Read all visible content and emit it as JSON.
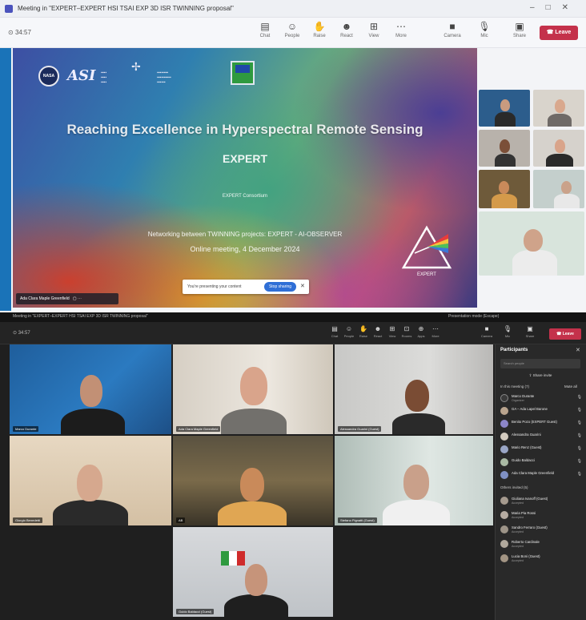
{
  "top_window": {
    "title": "Meeting in \"EXPERT–EXPERT HSI TSAI EXP 3D ISR TWINNING proposal\"",
    "timer": "34:57",
    "toolbar": [
      {
        "icon": "chat-icon",
        "label": "Chat"
      },
      {
        "icon": "people-icon",
        "label": "People"
      },
      {
        "icon": "raise-hand-icon",
        "label": "Raise"
      },
      {
        "icon": "react-icon",
        "label": "React"
      },
      {
        "icon": "view-icon",
        "label": "View"
      },
      {
        "icon": "more-icon",
        "label": "More"
      },
      {
        "icon": "camera-icon",
        "label": "Camera"
      },
      {
        "icon": "mic-icon",
        "label": "Mic"
      },
      {
        "icon": "share-icon",
        "label": "Share"
      }
    ],
    "leave_label": "Leave",
    "slide": {
      "logo_nasa": "NASA",
      "logo_asi": "ASI",
      "title": "Reaching Excellence in Hyperspectral Remote Sensing",
      "subtitle": "EXPERT",
      "consortium": "EXPERT Consortium",
      "networking": "Networking between TWINNING projects: EXPERT - AI-OBSERVER",
      "online": "Online meeting, 4 December 2024",
      "prism_label": "EXPERT"
    },
    "share_bar": {
      "text": "You're presenting your content",
      "stop_label": "Stop sharing"
    },
    "presenter_name": "Ada Clara Maple Greenfield"
  },
  "bottom_window": {
    "title": "Meeting in \"EXPERT–EXPERT HSI TSAI EXP 3D ISR TWINNING proposal\"",
    "title_right": "Presentation mode (Escape)",
    "timer": "34:57",
    "toolbar": [
      {
        "icon": "chat-icon",
        "label": "Chat"
      },
      {
        "icon": "people-icon",
        "label": "People"
      },
      {
        "icon": "raise-hand-icon",
        "label": "Raise"
      },
      {
        "icon": "react-icon",
        "label": "React"
      },
      {
        "icon": "view-icon",
        "label": "View"
      },
      {
        "icon": "rooms-icon",
        "label": "Rooms"
      },
      {
        "icon": "apps-icon",
        "label": "Apps"
      },
      {
        "icon": "more-icon",
        "label": "More"
      },
      {
        "icon": "camera-icon",
        "label": "Camera"
      },
      {
        "icon": "mic-icon",
        "label": "Mic"
      },
      {
        "icon": "share-icon",
        "label": "Share"
      }
    ],
    "leave_label": "Leave",
    "tiles": [
      {
        "name": "Marco Durante"
      },
      {
        "name": "Ada Clara Maple Greenfield"
      },
      {
        "name": "Alessandra Guarini (Guest)"
      },
      {
        "name": "Giorgio Benedetti"
      },
      {
        "name": "AB"
      },
      {
        "name": "Stefano Pignatti (Guest)"
      },
      {
        "name": "Guido Baldacci (Guest)"
      }
    ],
    "participants": {
      "title": "Participants",
      "search_placeholder": "Search people",
      "share_invite": "Share invite",
      "in_meeting_label": "In this meeting (7)",
      "mute_all": "Mute all",
      "in_meeting": [
        {
          "name": "Marco Durante",
          "status": "Organizer"
        },
        {
          "name": "GA – Ada Lapel Barone",
          "status": ""
        },
        {
          "name": "Benito Pozo (EXPERT Guest)",
          "status": ""
        },
        {
          "name": "Alessandra Guarini",
          "status": ""
        },
        {
          "name": "Mario Renz (Guest)",
          "status": ""
        },
        {
          "name": "Guido Baldacci",
          "status": ""
        },
        {
          "name": "Ada Clara Maple Greenfield",
          "status": ""
        }
      ],
      "others_label": "Others invited (5)",
      "others": [
        {
          "name": "Giuliana Ivanoff (Guest)",
          "status": "Accepted"
        },
        {
          "name": "Maria Pia Rossi",
          "status": "Accepted"
        },
        {
          "name": "Sandro Ferraro (Guest)",
          "status": "Accepted"
        },
        {
          "name": "Roberto Cardinale",
          "status": "Accepted"
        },
        {
          "name": "Lucia Boni (Guest)",
          "status": "Accepted"
        }
      ]
    }
  },
  "colors": {
    "teams_purple": "#4b53bc",
    "leave_red": "#c4314b",
    "accent_blue": "#1a73b8",
    "dark_bg": "#1f1f1f"
  }
}
